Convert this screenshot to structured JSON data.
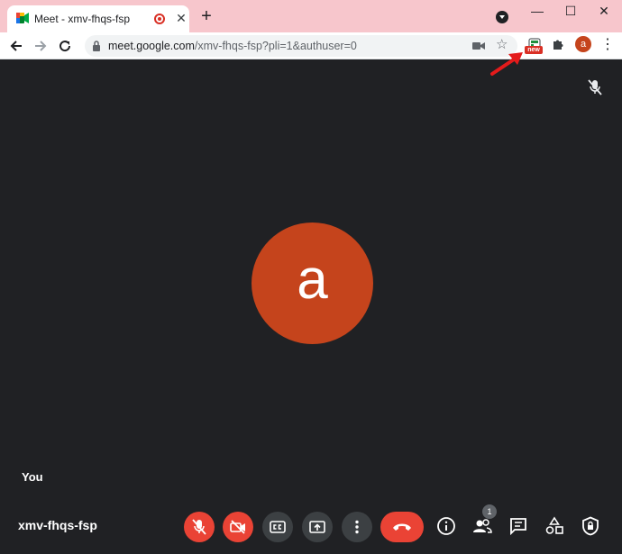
{
  "browser": {
    "tab": {
      "title": "Meet - xmv-fhqs-fsp"
    },
    "new_tab_label": "+",
    "window": {
      "minimize": "—",
      "restore": "☐",
      "close": "✕"
    },
    "url_host": "meet.google.com",
    "url_path": "/xmv-fhqs-fsp?pli=1&authuser=0",
    "extension_badge": "new",
    "profile_initial": "a",
    "menu": "⋮"
  },
  "meet": {
    "participant_initial": "a",
    "self_label": "You",
    "meeting_code": "xmv-fhqs-fsp",
    "people_count": "1"
  },
  "colors": {
    "titlebar": "#f7c6cc",
    "background": "#202124",
    "avatar": "#c5441c",
    "danger": "#ea4335",
    "control_grey": "#3c4043"
  },
  "icons": [
    "back-icon",
    "forward-icon",
    "reload-icon",
    "lock-icon",
    "camera-icon",
    "star-icon",
    "extension-icon",
    "puzzle-icon",
    "mic-off-icon",
    "camera-off-icon",
    "captions-icon",
    "present-icon",
    "more-icon",
    "end-call-icon",
    "info-icon",
    "people-icon",
    "chat-icon",
    "activities-icon",
    "host-controls-icon"
  ]
}
